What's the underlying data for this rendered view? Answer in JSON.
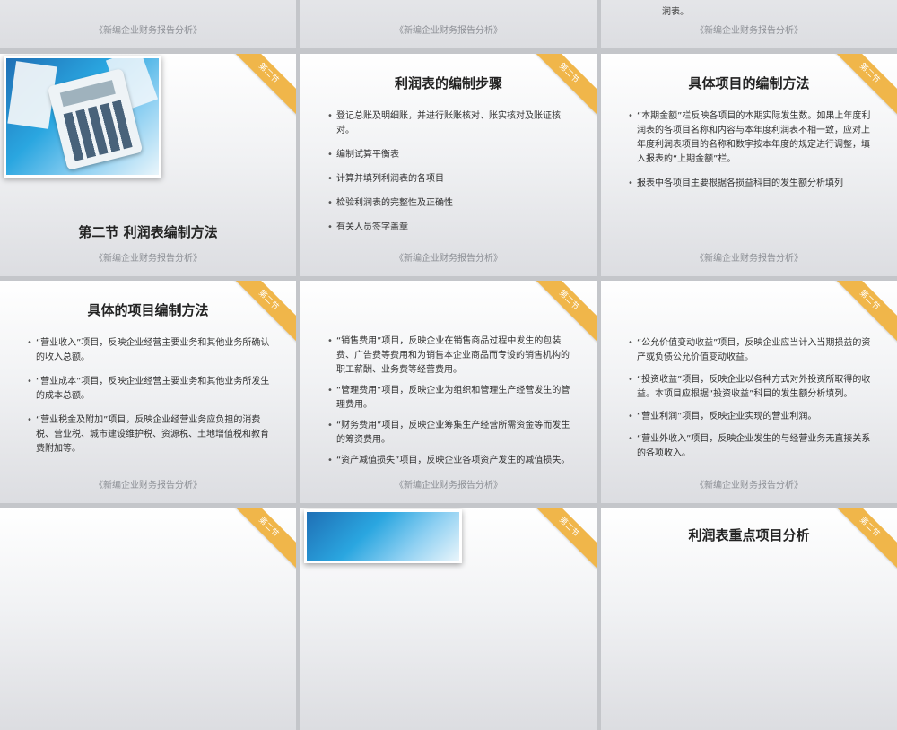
{
  "footer_text": "《新编企业财务报告分析》",
  "corner_label": "第二节",
  "slide1": {
    "text": "润表。"
  },
  "slide4": {
    "title": "第二节 利润表编制方法"
  },
  "slide5": {
    "title": "利润表的编制步骤",
    "bullets": [
      "登记总账及明细账，并进行账账核对、账实核对及账证核对。",
      "编制试算平衡表",
      "计算并填列利润表的各项目",
      "检验利润表的完整性及正确性",
      "有关人员签字盖章"
    ]
  },
  "slide6": {
    "title": "具体项目的编制方法",
    "bullets": [
      "“本期金额”栏反映各项目的本期实际发生数。如果上年度利润表的各项目名称和内容与本年度利润表不相一致，应对上年度利润表项目的名称和数字按本年度的规定进行调整，填入报表的“上期金额”栏。",
      "报表中各项目主要根据各损益科目的发生额分析填列"
    ]
  },
  "slide7": {
    "title": "具体的项目编制方法",
    "bullets": [
      "“营业收入”项目，反映企业经营主要业务和其他业务所确认的收入总额。",
      "“营业成本”项目，反映企业经营主要业务和其他业务所发生的成本总额。",
      "“营业税金及附加”项目，反映企业经营业务应负担的消费税、营业税、城市建设维护税、资源税、土地增值税和教育费附加等。"
    ]
  },
  "slide8": {
    "bullets": [
      "“销售费用”项目，反映企业在销售商品过程中发生的包装费、广告费等费用和为销售本企业商品而专设的销售机构的职工薪酬、业务费等经营费用。",
      "“管理费用”项目，反映企业为组织和管理生产经营发生的管理费用。",
      "“财务费用”项目，反映企业筹集生产经营所需资金等而发生的筹资费用。",
      "“资产减值损失”项目，反映企业各项资产发生的减值损失。"
    ]
  },
  "slide9": {
    "bullets": [
      "“公允价值变动收益”项目，反映企业应当计入当期损益的资产或负债公允价值变动收益。",
      "“投资收益”项目，反映企业以各种方式对外投资所取得的收益。本项目应根据“投资收益”科目的发生额分析填列。",
      "“营业利润”项目，反映企业实现的营业利润。",
      "“营业外收入”项目，反映企业发生的与经营业务无直接关系的各项收入。"
    ]
  },
  "slide12": {
    "title": "利润表重点项目分析"
  }
}
